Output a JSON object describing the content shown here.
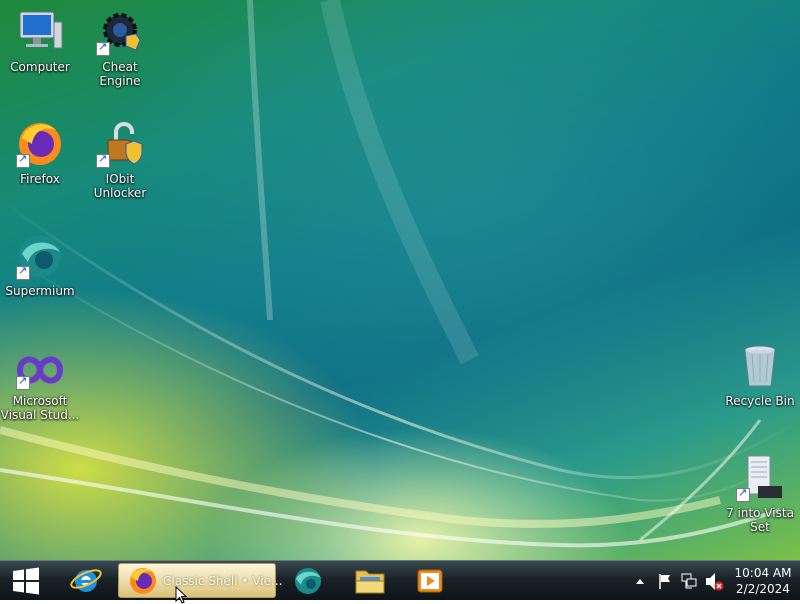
{
  "desktop": {
    "icons": [
      {
        "label": "Computer",
        "icon": "computer-icon"
      },
      {
        "label": "Cheat Engine",
        "icon": "cheat-engine-icon"
      },
      {
        "label": "Firefox",
        "icon": "firefox-icon"
      },
      {
        "label": "IObit Unlocker",
        "icon": "unlocker-icon"
      },
      {
        "label": "Supermium",
        "icon": "supermium-icon"
      },
      {
        "label": "Microsoft Visual Stud...",
        "icon": "visual-studio-icon"
      },
      {
        "label": "Recycle Bin",
        "icon": "recycle-bin-icon"
      },
      {
        "label": "7 into Vista Set",
        "icon": "setup-icon"
      }
    ]
  },
  "taskbar": {
    "active_window": "Classic Shell • Vie...",
    "pinned": [
      "internet-explorer-icon",
      "firefox-icon",
      "supermium-icon",
      "file-explorer-icon",
      "media-player-icon"
    ],
    "clock_time": "10:04 AM",
    "clock_date": "2/2/2024"
  },
  "colors": {
    "taskbar": "#1b2328",
    "active_task": "#e8d8a0",
    "accent": "#1a58c8"
  }
}
